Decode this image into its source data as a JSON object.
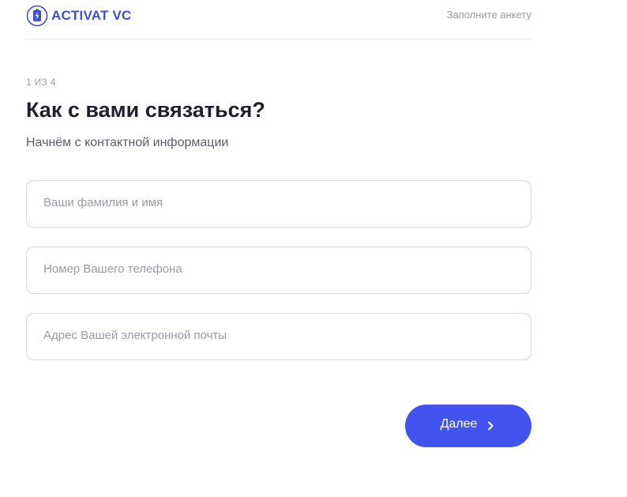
{
  "header": {
    "logo_text": "ACTIVAT VC",
    "link_label": "Заполните анкету"
  },
  "form": {
    "step_label": "1 ИЗ 4",
    "title": "Как с вами связаться?",
    "subtitle": "Начнём с контактной информации",
    "fields": [
      {
        "placeholder": "Ваши фамилия и имя",
        "value": ""
      },
      {
        "placeholder": "Номер Вашего телефона",
        "value": ""
      },
      {
        "placeholder": "Адрес Вашей электронной почты",
        "value": ""
      }
    ],
    "next_label": "Далее"
  },
  "icons": {
    "logo": "battery-bolt-icon",
    "next": "chevron-right-icon"
  },
  "colors": {
    "brand": "#3f4fd0",
    "button": "#4353f0",
    "border": "#d8d8df",
    "muted_text": "#9a9aa6"
  }
}
